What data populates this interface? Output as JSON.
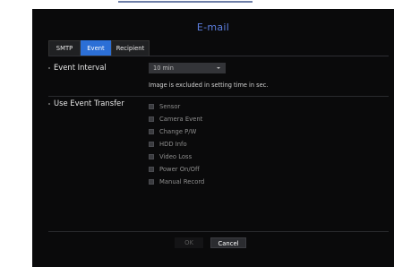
{
  "dialog": {
    "title": "E-mail"
  },
  "tabs": [
    {
      "label": "SMTP"
    },
    {
      "label": "Event"
    },
    {
      "label": "Recipient"
    }
  ],
  "event_interval": {
    "label": "Event Interval",
    "value": "10 min",
    "note": "Image is excluded in setting time in sec."
  },
  "event_transfer": {
    "label": "Use Event Transfer",
    "items": [
      {
        "label": "Sensor",
        "checked": false
      },
      {
        "label": "Camera Event",
        "checked": false
      },
      {
        "label": "Change P/W",
        "checked": false
      },
      {
        "label": "HDD Info",
        "checked": false
      },
      {
        "label": "Video Loss",
        "checked": false
      },
      {
        "label": "Power On/Off",
        "checked": false
      },
      {
        "label": "Manual Record",
        "checked": false
      }
    ]
  },
  "buttons": {
    "ok_label": "OK",
    "cancel_label": "Cancel"
  },
  "colors": {
    "accent": "#2c6fd6",
    "title": "#5d7fe0",
    "panel": "#0a0a0b"
  }
}
